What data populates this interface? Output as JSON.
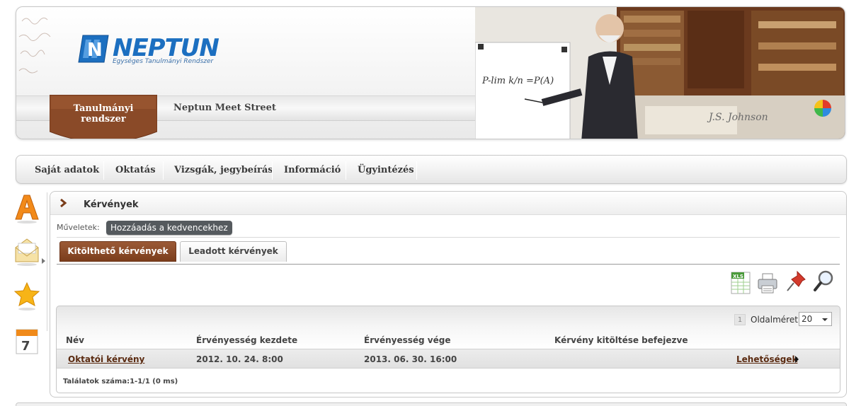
{
  "header": {
    "logo_text": "NEPTUN",
    "logo_subtitle": "Egységes Tanulmányi Rendszer",
    "tabs": [
      {
        "label": "Tanulmányi rendszer",
        "active": true
      },
      {
        "label": "Neptun Meet Street",
        "active": false
      }
    ]
  },
  "main_menu": {
    "items": [
      {
        "label": "Saját adatok"
      },
      {
        "label": "Oktatás"
      },
      {
        "label": "Vizsgák, jegybeírás"
      },
      {
        "label": "Információ"
      },
      {
        "label": "Ügyintézés"
      }
    ]
  },
  "sidebar": {
    "icons": [
      "font-a-icon",
      "envelope-icon",
      "star-icon",
      "calendar-icon"
    ],
    "calendar_day": "7"
  },
  "panel": {
    "title": "Kérvények",
    "operations_label": "Műveletek:",
    "favorite_button": "Hozzáadás a kedvencekhez",
    "tabs": [
      {
        "label": "Kitölthető kérvények",
        "active": true
      },
      {
        "label": "Leadott kérvények",
        "active": false
      }
    ],
    "toolbar": {
      "xls_label": "XLS"
    },
    "grid": {
      "page_number": "1",
      "page_size_label": "Oldalméret",
      "page_size_value": "20",
      "columns": [
        "Név",
        "Érvényesség kezdete",
        "Érvényesség vége",
        "Kérvény kitöltése befejezve"
      ],
      "rows": [
        {
          "name": "Oktatói kérvény",
          "start": "2012. 10. 24. 8:00",
          "end": "2013. 06. 30. 16:00",
          "completed": "",
          "action": "Lehetőségek"
        }
      ],
      "results_count": "Találatok száma:1-1/1 (0 ms)"
    }
  },
  "colors": {
    "brand_blue": "#1c6fc0",
    "active_tab_brown": "#8a4a28",
    "link_brown": "#5a2a10"
  }
}
